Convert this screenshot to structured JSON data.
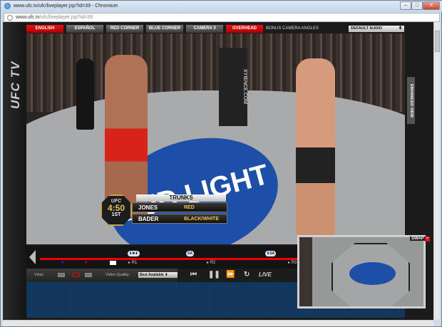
{
  "window": {
    "title": "www.ufc.tv/ufc/liveplayer.jsp?id=39 - Chromium",
    "url_host": "www.ufc.tv",
    "url_path": "/ufc/liveplayer.jsp?id=39",
    "minimize": "–",
    "maximize": "□",
    "close": "X"
  },
  "tabs": [
    {
      "label": "ENGLISH",
      "active": true
    },
    {
      "label": "ESPAÑOL",
      "active": false
    },
    {
      "label": "RED CORNER",
      "active": false
    },
    {
      "label": "BLUE CORNER",
      "active": false
    },
    {
      "label": "CAMERA 3",
      "active": false
    },
    {
      "label": "OVERHEAD",
      "active": true
    }
  ],
  "bonus_label": "BONUS CAMERA ANGLES",
  "audio_select": "DEFAULT AUDIO",
  "logo": "UFC TV",
  "enhanced_view": "ENHANCED VIEW",
  "lower_third": {
    "org": "UFC",
    "clock": "4:50",
    "round": "1ST",
    "header": "TRUNKS",
    "rows": [
      {
        "name": "JONES",
        "value": "RED"
      },
      {
        "name": "BADER",
        "value": "BLACK/WHITE"
      }
    ]
  },
  "video_text": {
    "banner": "XYIENCE.COM",
    "bud": "BUD LIGHT"
  },
  "timeline": {
    "badges": [
      "⬇✖⬇",
      "SA",
      "⬇SA"
    ],
    "rounds": [
      "R1",
      "R2",
      "R3"
    ]
  },
  "controls": {
    "view_label": "View:",
    "quality_label": "Video Quality:",
    "quality_value": "Best Available ⬍",
    "live": "LIVE",
    "prev": "⏮",
    "pause": "❚❚",
    "ff": "⏩",
    "replay": "↻"
  },
  "pip": {
    "swap": "SWAP",
    "close": "×"
  }
}
